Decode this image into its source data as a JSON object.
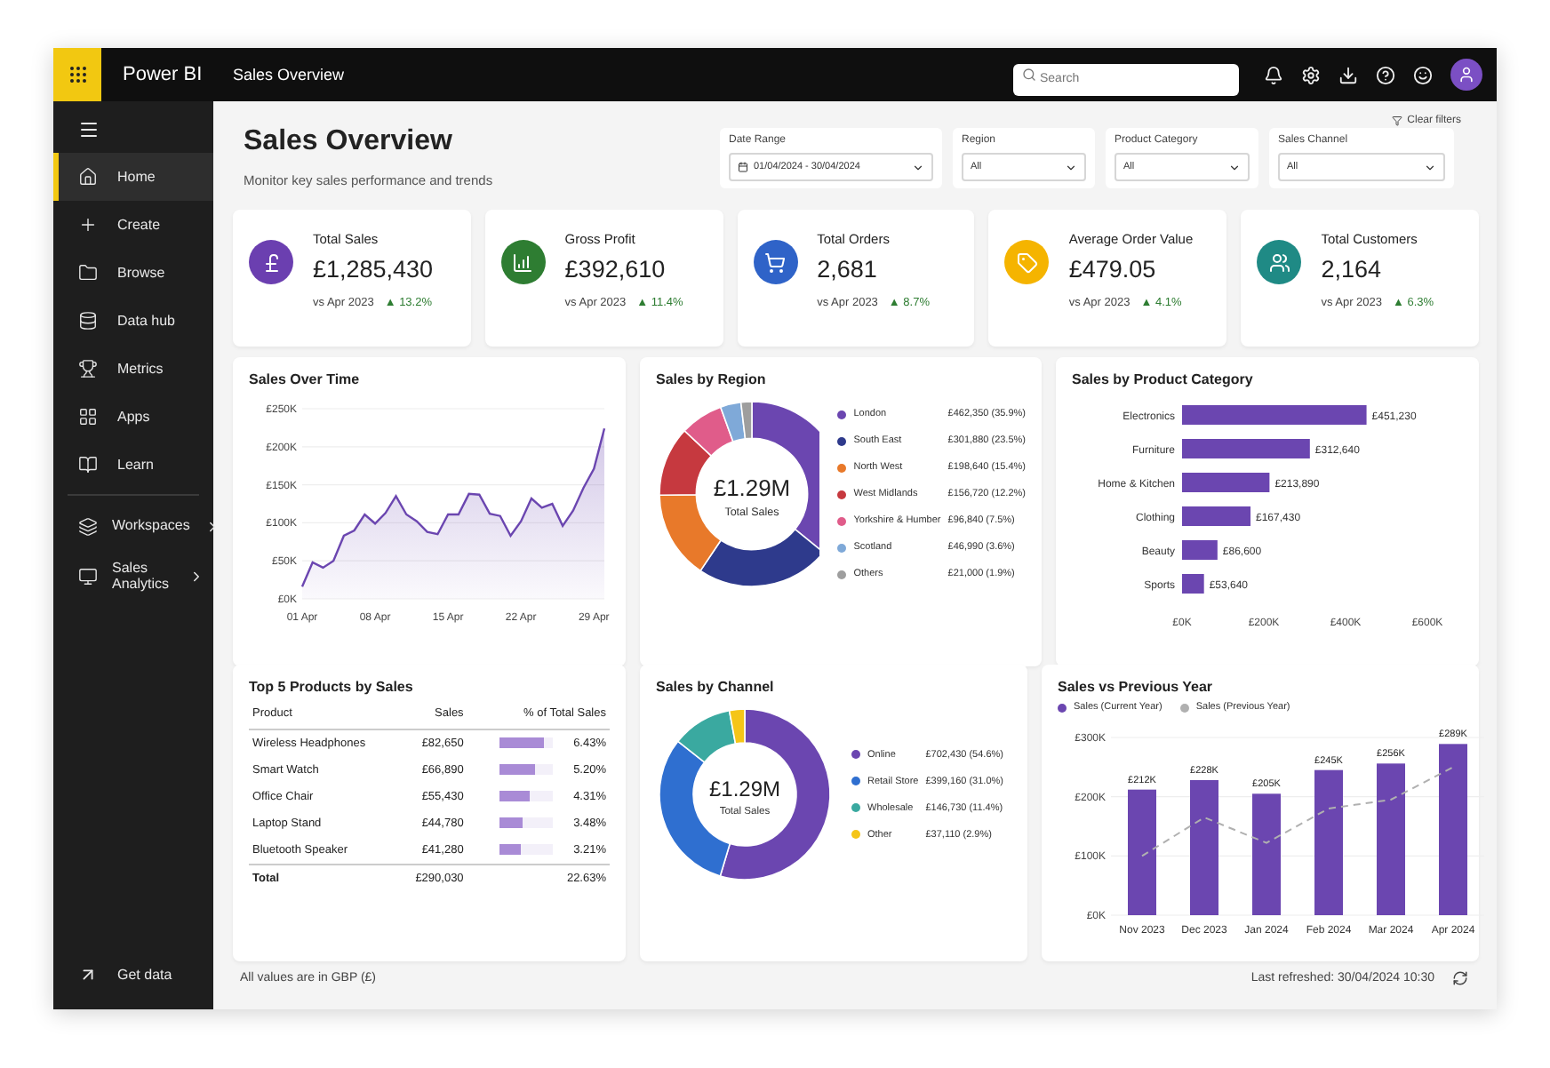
{
  "topbar": {
    "app_name": "Power BI",
    "report_title": "Sales Overview",
    "search": {
      "placeholder": "Search"
    }
  },
  "sidebar": {
    "items": [
      {
        "label": "Home",
        "selected": true,
        "kind": "link"
      },
      {
        "label": "Create",
        "selected": false,
        "kind": "link"
      },
      {
        "label": "Browse",
        "selected": false,
        "kind": "link"
      },
      {
        "label": "Data hub",
        "selected": false,
        "kind": "link"
      },
      {
        "label": "Metrics",
        "selected": false,
        "kind": "link"
      },
      {
        "label": "Apps",
        "selected": false,
        "kind": "link"
      },
      {
        "label": "Learn",
        "selected": false,
        "kind": "link"
      },
      {
        "label": "Workspaces",
        "selected": false,
        "kind": "group"
      },
      {
        "label": "Sales Analytics",
        "selected": false,
        "kind": "group"
      }
    ],
    "footer_item": {
      "label": "Get data"
    }
  },
  "header": {
    "title": "Sales Overview",
    "subtitle": "Monitor key sales performance and trends",
    "clear_filters": "Clear filters"
  },
  "filters": [
    {
      "label": "Date Range",
      "value": "01/04/2024 - 30/04/2024",
      "kind": "date"
    },
    {
      "label": "Region",
      "value": "All",
      "kind": "select"
    },
    {
      "label": "Product Category",
      "value": "All",
      "kind": "select"
    },
    {
      "label": "Sales Channel",
      "value": "All",
      "kind": "select"
    }
  ],
  "kpis": [
    {
      "title": "Total Sales",
      "value": "£1,285,430",
      "compare": "vs Apr 2023",
      "delta": "▲ 13.2%",
      "color": "#6b3fb0"
    },
    {
      "title": "Gross Profit",
      "value": "£392,610",
      "compare": "vs Apr 2023",
      "delta": "▲ 11.4%",
      "color": "#2e7d32"
    },
    {
      "title": "Total Orders",
      "value": "2,681",
      "compare": "vs Apr 2023",
      "delta": "▲ 8.7%",
      "color": "#2f63c8"
    },
    {
      "title": "Average Order Value",
      "value": "£479.05",
      "compare": "vs Apr 2023",
      "delta": "▲ 4.1%",
      "color": "#f5b400"
    },
    {
      "title": "Total Customers",
      "value": "2,164",
      "compare": "vs Apr 2023",
      "delta": "▲ 6.3%",
      "color": "#1f8a85"
    }
  ],
  "sales_over_time": {
    "title": "Sales Over Time",
    "chart_data": {
      "type": "area",
      "categories": [
        "01 Apr",
        null,
        null,
        null,
        null,
        null,
        null,
        "08 Apr",
        null,
        null,
        null,
        null,
        null,
        null,
        "15 Apr",
        null,
        null,
        null,
        null,
        null,
        null,
        "22 Apr",
        null,
        null,
        null,
        null,
        null,
        null,
        "29 Apr",
        null
      ],
      "values": [
        16000,
        48000,
        41000,
        50000,
        83000,
        90000,
        111000,
        99000,
        113000,
        135000,
        111000,
        102000,
        88000,
        85000,
        111000,
        111000,
        138000,
        137000,
        112000,
        109000,
        83000,
        102000,
        132000,
        120000,
        125000,
        96000,
        116000,
        146000,
        171000,
        224000
      ],
      "ylim": [
        0,
        250000
      ],
      "grid": true,
      "yticks": [
        {
          "value": 0,
          "label": "£0K"
        },
        {
          "value": 50000,
          "label": "£50K"
        },
        {
          "value": 100000,
          "label": "£100K"
        },
        {
          "value": 150000,
          "label": "£150K"
        },
        {
          "value": 200000,
          "label": "£200K"
        },
        {
          "value": 250000,
          "label": "£250K"
        }
      ]
    }
  },
  "sales_by_region": {
    "title": "Sales by Region",
    "center_value": "£1.29M",
    "center_label": "Total Sales",
    "legend": [
      {
        "color": "#6b46b0"
      },
      {
        "color": "#2e3a8c"
      },
      {
        "color": "#e8792a"
      },
      {
        "color": "#c6393f"
      },
      {
        "color": "#e05c8a"
      },
      {
        "color": "#7fa9d8"
      },
      {
        "color": "#9e9e9e"
      }
    ],
    "chart_data": {
      "type": "donut",
      "categories": [
        "London",
        "South East",
        "North West",
        "West Midlands",
        "Yorkshire & Humber",
        "Scotland",
        "Others"
      ],
      "values": [
        35.9,
        23.5,
        15.4,
        12.2,
        7.5,
        3.6,
        1.9
      ],
      "value_labels": [
        "£462,350 (35.9%)",
        "£301,880 (23.5%)",
        "£198,640 (15.4%)",
        "£156,720 (12.2%)",
        "£96,840 (7.5%)",
        "£46,990 (3.6%)",
        "£21,000 (1.9%)"
      ]
    }
  },
  "sales_by_category": {
    "title": "Sales by Product Category",
    "chart_data": {
      "type": "bar",
      "orientation": "horizontal",
      "categories": [
        "Electronics",
        "Furniture",
        "Home & Kitchen",
        "Clothing",
        "Beauty",
        "Sports"
      ],
      "values": [
        451230,
        312640,
        213890,
        167430,
        86600,
        53640
      ],
      "value_labels": [
        "£451,230",
        "£312,640",
        "£213,890",
        "£167,430",
        "£86,600",
        "£53,640"
      ],
      "xlim": [
        0,
        600000
      ],
      "xticks": [
        {
          "value": 0,
          "label": "£0K"
        },
        {
          "value": 200000,
          "label": "£200K"
        },
        {
          "value": 400000,
          "label": "£400K"
        },
        {
          "value": 600000,
          "label": "£600K"
        }
      ]
    }
  },
  "top_products": {
    "title": "Top 5 Products by Sales",
    "columns": [
      "Product",
      "Sales",
      "% of Total Sales"
    ],
    "rows": [
      {
        "product": "Wireless Headphones",
        "sales": "£82,650",
        "share": "6.43%",
        "level": 0.85
      },
      {
        "product": "Smart Watch",
        "sales": "£66,890",
        "share": "5.20%",
        "level": 0.69
      },
      {
        "product": "Office Chair",
        "sales": "£55,430",
        "share": "4.31%",
        "level": 0.57
      },
      {
        "product": "Laptop Stand",
        "sales": "£44,780",
        "share": "3.48%",
        "level": 0.46
      },
      {
        "product": "Bluetooth Speaker",
        "sales": "£41,280",
        "share": "3.21%",
        "level": 0.42
      }
    ],
    "total": {
      "label": "Total",
      "sales": "£290,030",
      "share": "22.63%"
    }
  },
  "sales_by_channel": {
    "title": "Sales by Channel",
    "center_value": "£1.29M",
    "center_label": "Total Sales",
    "legend": [
      {
        "color": "#6b46b0"
      },
      {
        "color": "#2f6fd0"
      },
      {
        "color": "#3aa9a0"
      },
      {
        "color": "#f5c518"
      }
    ],
    "chart_data": {
      "type": "donut",
      "categories": [
        "Online",
        "Retail Store",
        "Wholesale",
        "Other"
      ],
      "values": [
        54.6,
        31.0,
        11.4,
        2.9
      ],
      "value_labels": [
        "£702,430 (54.6%)",
        "£399,160 (31.0%)",
        "£146,730 (11.4%)",
        "£37,110 (2.9%)"
      ]
    }
  },
  "sales_vs_previous": {
    "title": "Sales vs Previous Year",
    "chart_data": {
      "type": "bar",
      "categories": [
        "Nov 2023",
        "Dec 2023",
        "Jan 2024",
        "Feb 2024",
        "Mar 2024",
        "Apr 2024"
      ],
      "series": [
        {
          "name": "Sales (Current Year)",
          "color": "#6b46b0",
          "type": "bar",
          "values": [
            212000,
            228000,
            205000,
            245000,
            256000,
            289000
          ]
        },
        {
          "name": "Sales (Previous Year)",
          "color": "#b0b0b0",
          "type": "line",
          "line_style": "dashed",
          "values": [
            100000,
            165000,
            122000,
            180000,
            195000,
            250000
          ]
        }
      ],
      "value_labels": [
        "£212K",
        "£228K",
        "£205K",
        "£245K",
        "£256K",
        "£289K"
      ],
      "ylim": [
        0,
        300000
      ],
      "grid": true,
      "yticks": [
        {
          "value": 0,
          "label": "£0K"
        },
        {
          "value": 100000,
          "label": "£100K"
        },
        {
          "value": 200000,
          "label": "£200K"
        },
        {
          "value": 300000,
          "label": "£300K"
        }
      ]
    }
  },
  "footer": {
    "note": "All values are in GBP (£)",
    "refreshed": "Last refreshed: 30/04/2024 10:30"
  }
}
